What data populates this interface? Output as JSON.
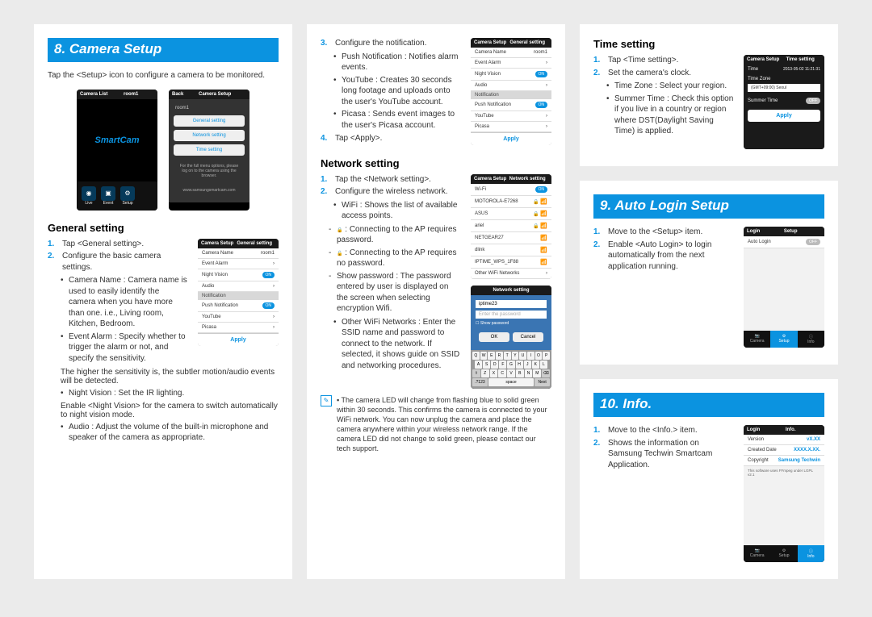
{
  "col1": {
    "section_title": "8. Camera Setup",
    "intro": "Tap the <Setup> icon to configure a camera to be monitored.",
    "phone_left": {
      "title_left": "Camera List",
      "title_mid": "room1",
      "logo": "SmartCam",
      "bar": [
        "Live",
        "Event",
        "Setup"
      ]
    },
    "phone_right": {
      "back": "Back",
      "title": "Camera Setup",
      "sub": "room1",
      "items": [
        "General setting",
        "Network setting",
        "Time setting"
      ],
      "note": "For the full menu options, please log on to the camera using the browser.",
      "url": "www.samsungsmartcam.com"
    },
    "general_title": "General setting",
    "g_step1": "Tap <General setting>.",
    "g_step2": "Configure the basic camera settings.",
    "g_b1": "Camera Name : Camera name is used to easily identify the camera when you have more than one. i.e., Living room, Kitchen, Bedroom.",
    "g_b2": "Event Alarm : Specify whether to trigger the alarm or not, and specify the sensitivity.",
    "g_b2b": "The higher the sensitivity is, the subtler motion/audio events will be detected.",
    "g_b3": "Night Vision : Set the IR lighting.",
    "g_b3b": "Enable <Night Vision> for the camera to switch automatically to night vision mode.",
    "g_b4": "Audio : Adjust the volume of the built-in microphone and speaker of the camera as appropriate.",
    "phone_general": {
      "hdr_l": "Camera Setup",
      "hdr_r": "General setting",
      "rows": [
        [
          "Camera Name",
          "room1"
        ],
        [
          "Event Alarm",
          ""
        ],
        [
          "Night Vision",
          "ON"
        ],
        [
          "Audio",
          ""
        ]
      ],
      "sec": "Notification",
      "rows2": [
        [
          "Push Notification",
          "ON"
        ],
        [
          "YouTube",
          ""
        ],
        [
          "Picasa",
          ""
        ]
      ],
      "apply": "Apply"
    }
  },
  "col2": {
    "s3": "Configure the notification.",
    "s3b1": "Push Notification : Notifies alarm events.",
    "s3b2": "YouTube : Creates 30 seconds long footage and uploads onto the user's YouTube account.",
    "s3b3": "Picasa : Sends event images to the user's Picasa account.",
    "s4": "Tap <Apply>.",
    "net_title": "Network setting",
    "n1": "Tap the <Network setting>.",
    "n2": "Configure the wireless network.",
    "n2b1": "WiFi : Shows the list of available access points.",
    "n2b1d1": " : Connecting to the AP requires password.",
    "n2b1d2": " : Connecting to the AP requires no password.",
    "n2b1d3": "Show password : The password entered by user is displayed on the screen when selecting encryption Wifi.",
    "n2b2": "Other WiFi Networks : Enter the SSID name and password to connect to the network. If selected, it shows guide on SSID and networking procedures.",
    "note": "The camera LED will change from flashing blue to solid green within 30 seconds. This confirms the camera is connected to your WiFi network. You can now unplug the camera and place the camera anywhere within your wireless network range. If the camera LED did not change to solid green, please contact our tech support.",
    "phone_general_copy": {
      "hdr_l": "Camera Setup",
      "hdr_r": "General setting",
      "rows": [
        [
          "Camera Name",
          "room1"
        ],
        [
          "Event Alarm",
          ""
        ],
        [
          "Night Vision",
          "ON"
        ],
        [
          "Audio",
          ""
        ]
      ],
      "sec": "Notification",
      "rows2": [
        [
          "Push Notification",
          "ON"
        ],
        [
          "YouTube",
          ""
        ],
        [
          "Picasa",
          ""
        ]
      ],
      "apply": "Apply"
    },
    "phone_net": {
      "hdr_l": "Camera Setup",
      "hdr_r": "Network setting",
      "wifi": "Wi-Fi",
      "on": "ON",
      "aps": [
        "MOTOROLA-E7268",
        "ASUS",
        "ariel",
        "NETGEAR27",
        "dlink",
        "IPTIME_WPS_1F88"
      ],
      "other": "Other WiFi Networks"
    },
    "phone_pwd": {
      "hdr": "Network setting",
      "sel": "iptime23",
      "ph": "Enter the password",
      "show": "Show password",
      "ok": "OK",
      "cancel": "Cancel",
      "keys": [
        [
          "Q",
          "W",
          "E",
          "R",
          "T",
          "Y",
          "U",
          "I",
          "O",
          "P"
        ],
        [
          "A",
          "S",
          "D",
          "F",
          "G",
          "H",
          "J",
          "K",
          "L"
        ],
        [
          "Z",
          "X",
          "C",
          "V",
          "B",
          "N",
          "M"
        ]
      ],
      "space": "space",
      "next": "Next",
      "n123": ".?123"
    }
  },
  "col3": {
    "time_title": "Time setting",
    "t1": "Tap <Time setting>.",
    "t2": "Set the camera's clock.",
    "t2b1": "Time Zone : Select your region.",
    "t2b2": "Summer Time : Check this option if you live in a country or region where DST(Daylight Saving Time) is applied.",
    "phone_time": {
      "hdr_l": "Camera Setup",
      "hdr_r": "Time setting",
      "row_time": "Time",
      "ts": "2013-05-02  11:21:31",
      "tz_lbl": "Time Zone",
      "tz_val": "(GMT+09:00) Seoul",
      "st_lbl": "Summer Time",
      "off": "OFF",
      "apply": "Apply"
    },
    "sec9_title": "9. Auto Login Setup",
    "al1": "Move to the <Setup> item.",
    "al2": "Enable <Auto Login> to login automatically from the next application running.",
    "phone_al": {
      "hdr_l": "Login",
      "hdr_r": "Setup",
      "row": "Auto Login",
      "off": "OFF",
      "nav": [
        "Camera",
        "Setup",
        "Info"
      ]
    },
    "sec10_title": "10. Info.",
    "i1": "Move to the <Info.> item.",
    "i2": "Shows the information on Samsung Techwin Smartcam Application.",
    "phone_info": {
      "hdr_l": "Login",
      "hdr_r": "Info.",
      "rows": [
        [
          "Version",
          "vX.XX"
        ],
        [
          "Created Date",
          "XXXX.X.XX."
        ],
        [
          "Copyright",
          "Samsung Techwin"
        ]
      ],
      "foot": "This software uses FFmpeg under LGPL v2.1",
      "nav": [
        "Camera",
        "Setup",
        "Info"
      ]
    }
  }
}
